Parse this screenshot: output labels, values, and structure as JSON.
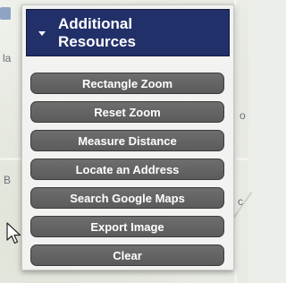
{
  "panel": {
    "title_line1": "Additional",
    "title_line2": "Resources",
    "header_color": "#22306a",
    "button_color": "#5f5f5f"
  },
  "buttons": [
    {
      "label": "Rectangle Zoom"
    },
    {
      "label": "Reset Zoom"
    },
    {
      "label": "Measure Distance"
    },
    {
      "label": "Locate an Address"
    },
    {
      "label": "Search Google Maps"
    },
    {
      "label": "Export Image"
    },
    {
      "label": "Clear"
    }
  ],
  "map_labels": {
    "left_top": "la",
    "left_mid": "B",
    "right_top": "o",
    "right_mid": "c"
  },
  "icons": {
    "collapse": "caret-down-icon",
    "cursor": "mouse-pointer-icon"
  }
}
